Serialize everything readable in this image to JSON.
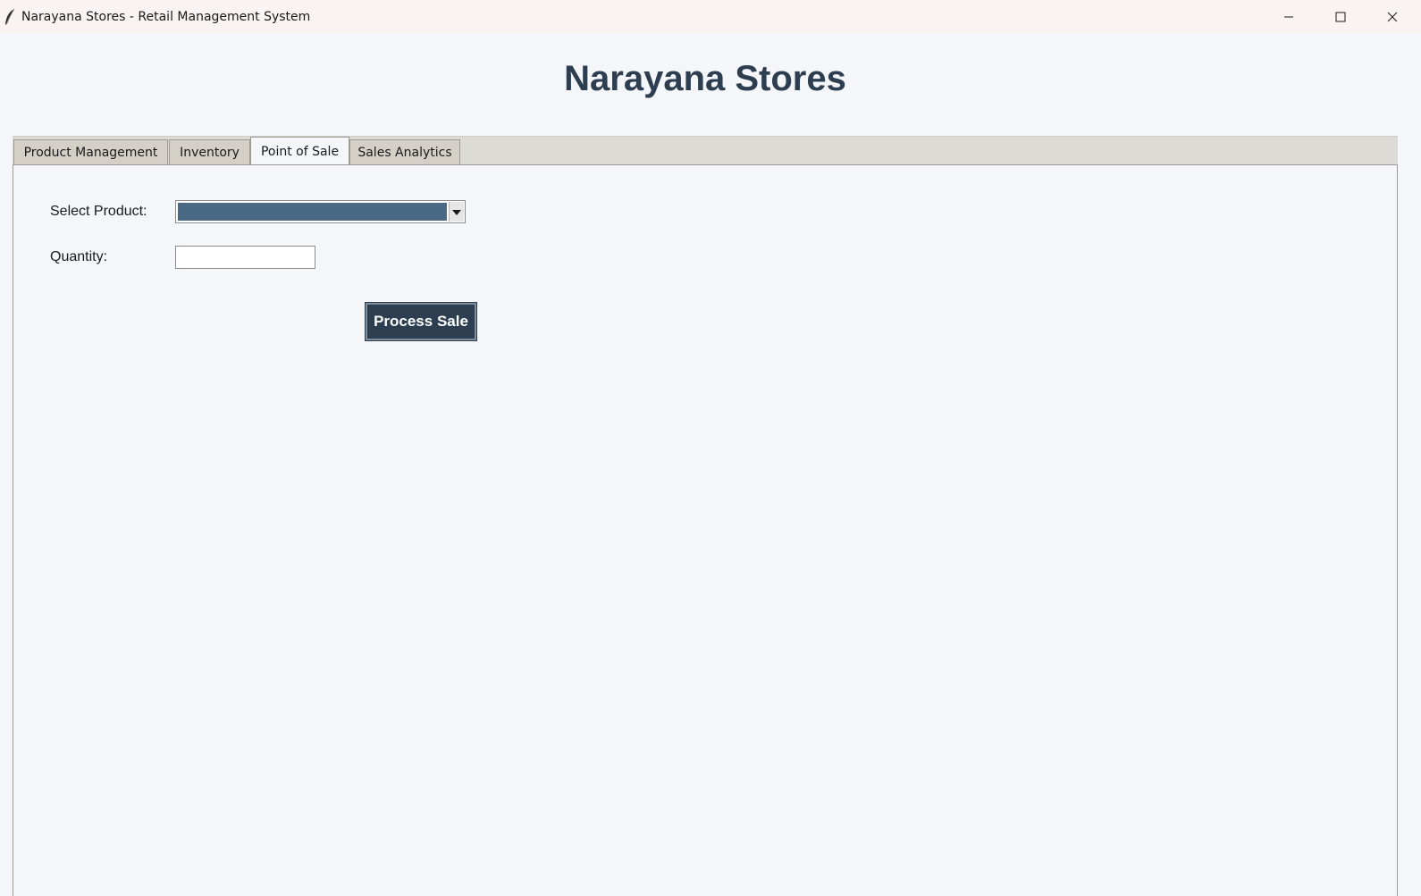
{
  "window": {
    "title": "Narayana Stores - Retail Management System",
    "icon": "feather-icon",
    "controls": [
      "minimize-icon",
      "maximize-icon",
      "close-icon"
    ]
  },
  "app": {
    "heading": "Narayana Stores"
  },
  "tabs": [
    {
      "label": "Product Management",
      "active": false
    },
    {
      "label": "Inventory",
      "active": false
    },
    {
      "label": "Point of Sale",
      "active": true
    },
    {
      "label": "Sales Analytics",
      "active": false
    }
  ],
  "pos": {
    "select_product_label": "Select Product:",
    "select_product_value": "",
    "quantity_label": "Quantity:",
    "quantity_value": "",
    "process_button_label": "Process Sale"
  },
  "colors": {
    "heading": "#2c3e50",
    "button_bg": "#2c3e50",
    "combo_highlight": "#4a6984",
    "background": "#f5f6f9"
  }
}
